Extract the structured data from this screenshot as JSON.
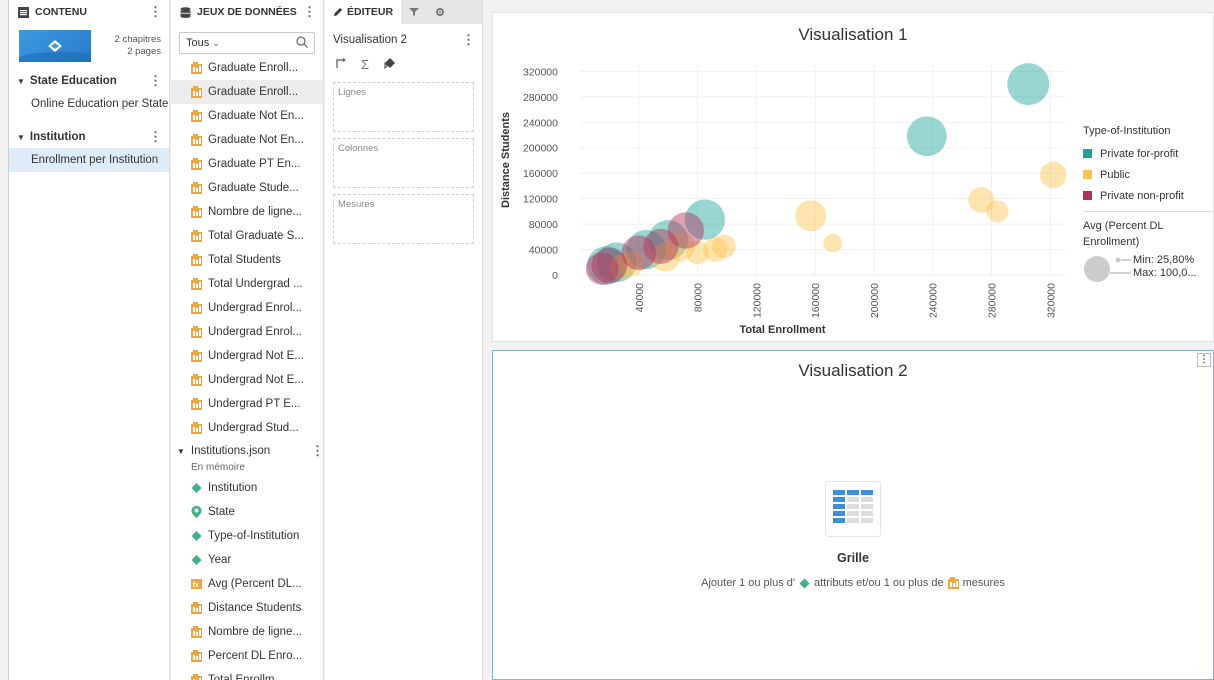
{
  "contents_panel": {
    "header": "CONTENU",
    "chapters_count": "2 chapitres",
    "pages_count": "2 pages",
    "chapters": [
      {
        "label": "State Education",
        "pages": [
          "Online Education per State"
        ]
      },
      {
        "label": "Institution",
        "pages": [
          "Enrollment per Institution"
        ]
      }
    ]
  },
  "datasets_panel": {
    "header": "JEUX DE DONNÉES",
    "filter": "Tous",
    "items": [
      "Graduate Enroll...",
      "Graduate Enroll...",
      "Graduate Not En...",
      "Graduate Not En...",
      "Graduate PT En...",
      "Graduate Stude...",
      "Nombre de ligne...",
      "Total Graduate S...",
      "Total Students",
      "Total Undergrad ...",
      "Undergrad Enrol...",
      "Undergrad Enrol...",
      "Undergrad Not E...",
      "Undergrad Not E...",
      "Undergrad PT E...",
      "Undergrad Stud..."
    ],
    "dataset": {
      "name": "Institutions.json",
      "status": "En mémoire",
      "attributes": [
        "Institution",
        "State",
        "Type-of-Institution",
        "Year"
      ],
      "metrics": [
        "Avg (Percent DL...",
        "Distance Students",
        "Nombre de ligne...",
        "Percent DL Enro...",
        "Total Enrollm..."
      ]
    }
  },
  "editor_panel": {
    "tab_editor": "ÉDITEUR",
    "vis_name": "Visualisation 2",
    "zones": [
      "Lignes",
      "Colonnes",
      "Mesures"
    ]
  },
  "vis1": {
    "title": "Visualisation 1",
    "legend": {
      "color_title": "Type-of-Institution",
      "items": [
        {
          "label": "Private for-profit",
          "color": "#1aa39a"
        },
        {
          "label": "Public",
          "color": "#fcc44d"
        },
        {
          "label": "Private non-profit",
          "color": "#b52f5c"
        }
      ],
      "size_title_1": "Avg (Percent DL",
      "size_title_2": "Enrollment)",
      "size_min": "Min: 25,80%",
      "size_max": "Max: 100,0..."
    }
  },
  "vis2": {
    "title": "Visualisation 2",
    "empty_title": "Grille",
    "hint_part1": "Ajouter 1 ou plus d'",
    "hint_part2": "attributs et/ou 1 ou plus de",
    "hint_part3": "mesures"
  },
  "chart_data": {
    "type": "scatter",
    "title": "Visualisation 1",
    "xlabel": "Total Enrollment",
    "ylabel": "Distance Students",
    "xlim": [
      0,
      330000
    ],
    "ylim": [
      0,
      330000
    ],
    "x_ticks": [
      40000,
      80000,
      120000,
      160000,
      200000,
      240000,
      280000,
      320000
    ],
    "y_ticks": [
      0,
      40000,
      80000,
      120000,
      160000,
      200000,
      240000,
      280000,
      320000
    ],
    "grid": true,
    "legend_placement": "right",
    "series": [
      {
        "name": "Private for-profit",
        "points": [
          {
            "x": 305000,
            "y": 300000,
            "size": 100
          },
          {
            "x": 236000,
            "y": 218000,
            "size": 90
          },
          {
            "x": 85000,
            "y": 87000,
            "size": 92
          },
          {
            "x": 60000,
            "y": 55000,
            "size": 90
          },
          {
            "x": 45000,
            "y": 40000,
            "size": 88
          },
          {
            "x": 25000,
            "y": 20000,
            "size": 90
          },
          {
            "x": 18000,
            "y": 15000,
            "size": 85
          }
        ]
      },
      {
        "name": "Public",
        "points": [
          {
            "x": 157000,
            "y": 93000,
            "size": 55
          },
          {
            "x": 322000,
            "y": 157000,
            "size": 40
          },
          {
            "x": 273000,
            "y": 118000,
            "size": 38
          },
          {
            "x": 284000,
            "y": 100000,
            "size": 28
          },
          {
            "x": 172000,
            "y": 50000,
            "size": 20
          },
          {
            "x": 92000,
            "y": 40000,
            "size": 34
          },
          {
            "x": 98000,
            "y": 45000,
            "size": 32
          },
          {
            "x": 80000,
            "y": 35000,
            "size": 30
          },
          {
            "x": 68000,
            "y": 45000,
            "size": 50
          },
          {
            "x": 58000,
            "y": 28000,
            "size": 48
          },
          {
            "x": 35000,
            "y": 18000,
            "size": 38
          },
          {
            "x": 28000,
            "y": 12000,
            "size": 34
          }
        ]
      },
      {
        "name": "Private non-profit",
        "points": [
          {
            "x": 72000,
            "y": 70000,
            "size": 75
          },
          {
            "x": 55000,
            "y": 45000,
            "size": 70
          },
          {
            "x": 40000,
            "y": 35000,
            "size": 68
          },
          {
            "x": 20000,
            "y": 15000,
            "size": 72
          },
          {
            "x": 15000,
            "y": 10000,
            "size": 60
          }
        ]
      }
    ]
  }
}
